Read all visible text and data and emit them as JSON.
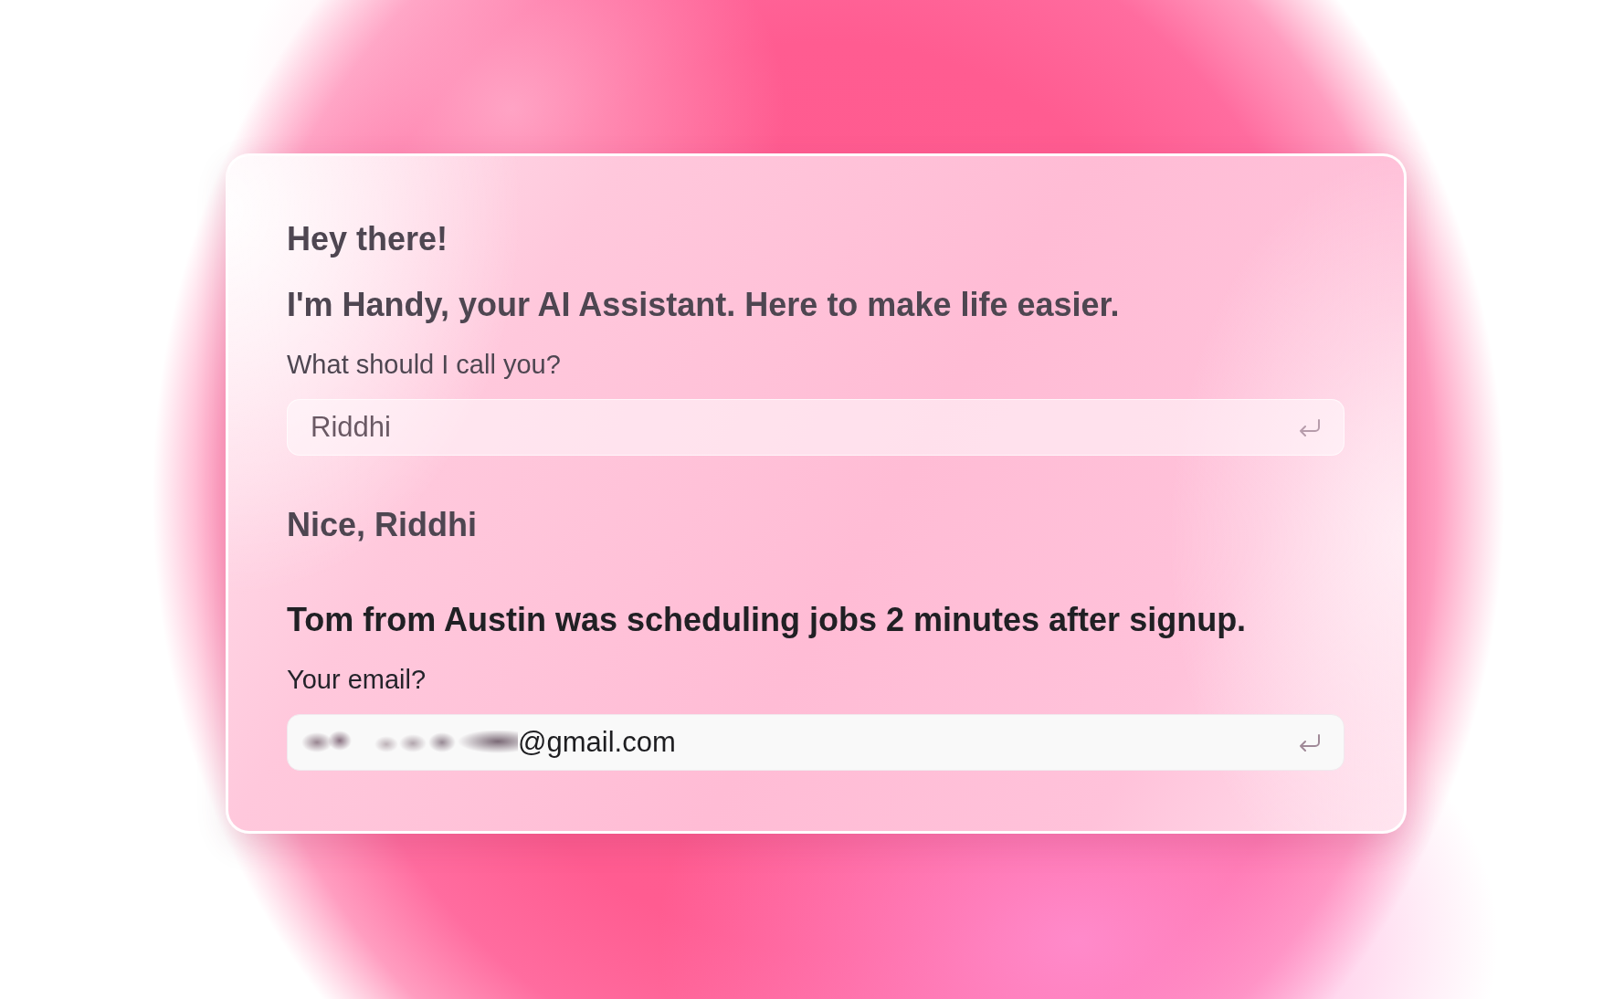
{
  "conversation": [
    {
      "kind": "answered",
      "messages": [
        "Hey there!",
        "I'm Handy, your AI Assistant. Here to make life easier."
      ],
      "question": "What should I call you?",
      "input": {
        "value": "Riddhi",
        "blurred_prefix": false
      },
      "reply": "Nice, Riddhi"
    },
    {
      "kind": "current",
      "messages": [
        "Tom from Austin was scheduling jobs 2 minutes after signup."
      ],
      "question": "Your email?",
      "input": {
        "value": "@gmail.com",
        "blurred_prefix": true
      }
    }
  ]
}
